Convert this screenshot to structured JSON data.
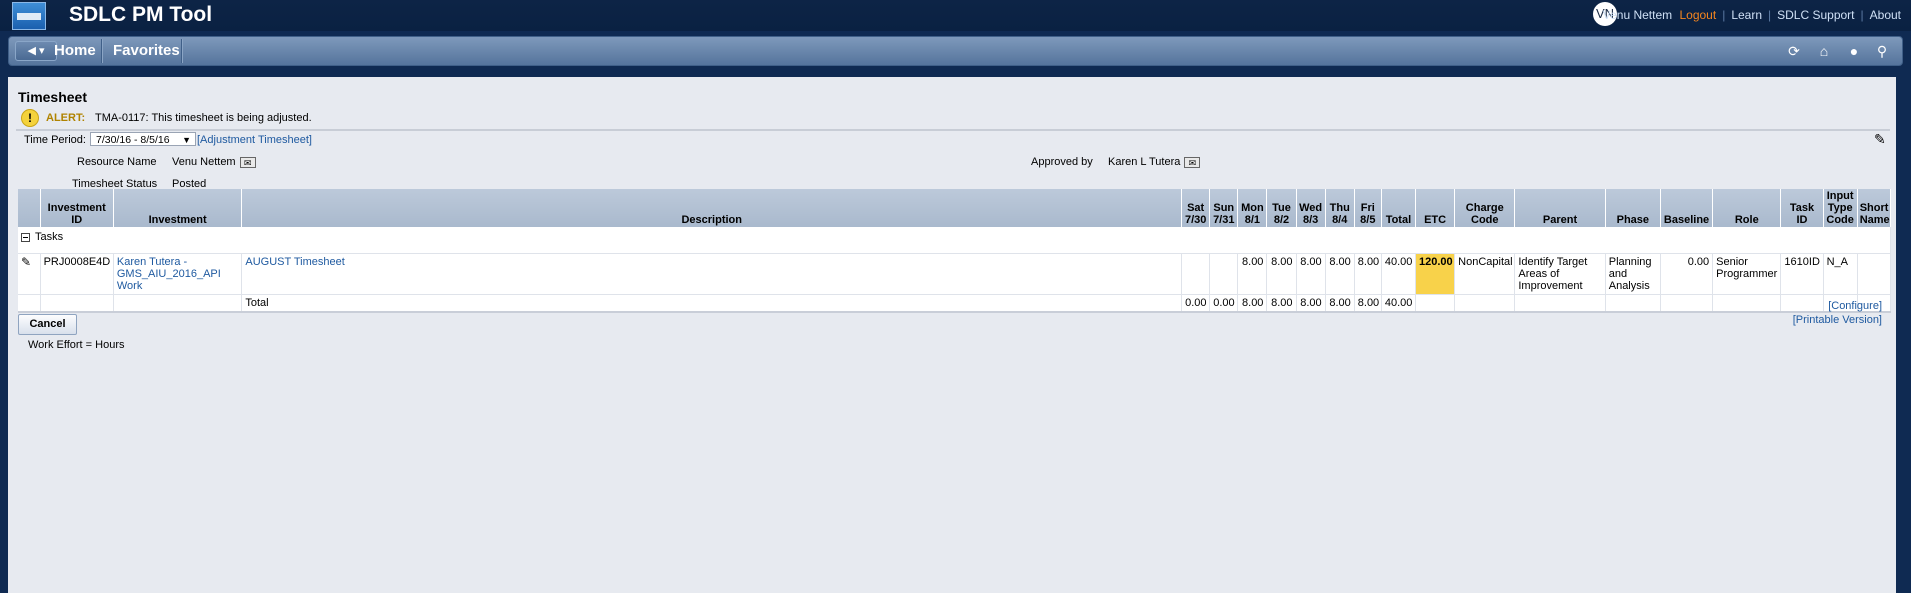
{
  "app": {
    "title": "SDLC PM Tool",
    "avatar_initials": "VN"
  },
  "top_links": {
    "user": "Venu Nettem",
    "logout": "Logout",
    "learn": "Learn",
    "support": "SDLC Support",
    "about": "About"
  },
  "nav": {
    "home": "Home",
    "favorites": "Favorites"
  },
  "page": {
    "title": "Timesheet",
    "alert_label": "ALERT:",
    "alert_text": "TMA-0117: This timesheet is being adjusted.",
    "time_period_label": "Time Period:",
    "time_period_value": "7/30/16 - 8/5/16",
    "adjustment_link": "[Adjustment Timesheet]",
    "resource_label": "Resource Name",
    "resource_value": "Venu Nettem",
    "approved_label": "Approved by",
    "approved_value": "Karen L Tutera",
    "status_label": "Timesheet Status",
    "status_value": "Posted"
  },
  "table": {
    "headers": {
      "investment_id": "Investment ID",
      "investment": "Investment",
      "description": "Description",
      "sat": "Sat 7/30",
      "sun": "Sun 7/31",
      "mon": "Mon 8/1",
      "tue": "Tue 8/2",
      "wed": "Wed 8/3",
      "thu": "Thu 8/4",
      "fri": "Fri 8/5",
      "total": "Total",
      "etc": "ETC",
      "charge_code": "Charge Code",
      "parent": "Parent",
      "phase": "Phase",
      "baseline": "Baseline",
      "role": "Role",
      "task_id": "Task ID",
      "input_type": "Input Type Code",
      "short_name": "Short Name"
    },
    "group_label": "Tasks",
    "row": {
      "investment_id": "PRJ0008E4D",
      "investment": "Karen Tutera - GMS_AIU_2016_API Work",
      "description": "AUGUST Timesheet",
      "sat": "",
      "sun": "",
      "mon": "8.00",
      "tue": "8.00",
      "wed": "8.00",
      "thu": "8.00",
      "fri": "8.00",
      "total": "40.00",
      "etc": "120.00",
      "charge_code": "NonCapital",
      "parent": "Identify Target Areas of Improvement",
      "phase": "Planning and Analysis",
      "baseline": "0.00",
      "role": "Senior Programmer",
      "task_id": "1610ID",
      "input_type": "N_A",
      "short_name": ""
    },
    "totals": {
      "label": "Total",
      "sat": "0.00",
      "sun": "0.00",
      "mon": "8.00",
      "tue": "8.00",
      "wed": "8.00",
      "thu": "8.00",
      "fri": "8.00",
      "total": "40.00"
    }
  },
  "links": {
    "configure": "[Configure]",
    "printable": "[Printable Version]"
  },
  "buttons": {
    "cancel": "Cancel"
  },
  "footer": {
    "work_effort": "Work Effort = Hours"
  },
  "colors": {
    "etc_highlight": "#f8d24a",
    "link": "#1f5aa0",
    "logout": "#f5861f"
  }
}
